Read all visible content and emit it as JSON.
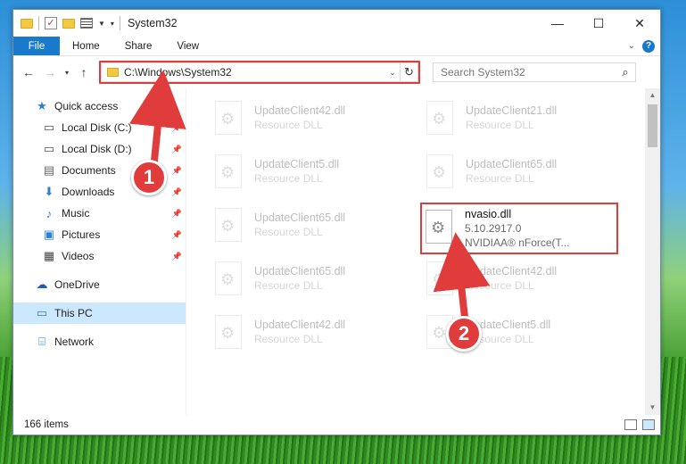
{
  "window": {
    "title": "System32",
    "controls": {
      "minimize": "—",
      "maximize": "☐",
      "close": "✕"
    }
  },
  "ribbon": {
    "file": "File",
    "tabs": [
      "Home",
      "Share",
      "View"
    ]
  },
  "navigation": {
    "address": "C:\\Windows\\System32",
    "search_placeholder": "Search System32"
  },
  "sidebar": {
    "quick_access": "Quick access",
    "items": [
      {
        "label": "Local Disk (C:)",
        "icon": "drive-icon",
        "pinned": true
      },
      {
        "label": "Local Disk (D:)",
        "icon": "drive-icon",
        "pinned": true
      },
      {
        "label": "Documents",
        "icon": "documents-icon",
        "pinned": true
      },
      {
        "label": "Downloads",
        "icon": "downloads-icon",
        "pinned": true
      },
      {
        "label": "Music",
        "icon": "music-icon",
        "pinned": true
      },
      {
        "label": "Pictures",
        "icon": "pictures-icon",
        "pinned": true
      },
      {
        "label": "Videos",
        "icon": "videos-icon",
        "pinned": true
      }
    ],
    "onedrive": "OneDrive",
    "this_pc": "This PC",
    "network": "Network"
  },
  "files": {
    "left": [
      {
        "name": "UpdateClient42.dll",
        "desc": "Resource DLL"
      },
      {
        "name": "UpdateClient5.dll",
        "desc": "Resource DLL"
      },
      {
        "name": "UpdateClient65.dll",
        "desc": "Resource DLL"
      },
      {
        "name": "UpdateClient65.dll",
        "desc": "Resource DLL"
      },
      {
        "name": "UpdateClient42.dll",
        "desc": "Resource DLL"
      }
    ],
    "right": [
      {
        "name": "UpdateClient21.dll",
        "desc": "Resource DLL"
      },
      {
        "name": "UpdateClient65.dll",
        "desc": "Resource DLL"
      },
      {
        "name": "UpdateClient42.dll",
        "desc": "Resource DLL"
      },
      {
        "name": "UpdateClient5.dll",
        "desc": "Resource DLL"
      }
    ],
    "highlighted": {
      "name": "nvasio.dll",
      "version": "5.10.2917.0",
      "company": "NVIDIAA® nForce(T..."
    }
  },
  "status": {
    "item_count": "166 items"
  },
  "callouts": {
    "one": "1",
    "two": "2"
  },
  "colors": {
    "accent": "#1979ca",
    "highlight_red": "#e03c3c",
    "selected_bg": "#cce8ff"
  }
}
